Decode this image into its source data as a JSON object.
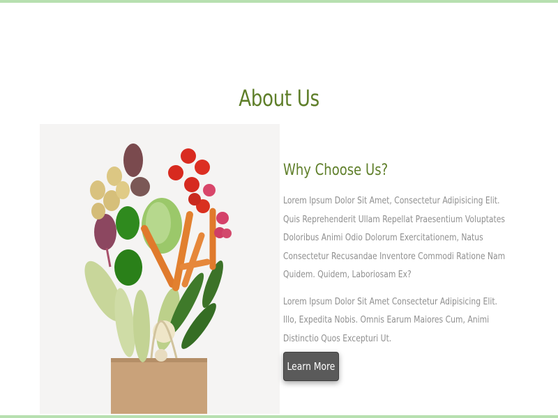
{
  "page": {
    "title": "About Us"
  },
  "image": {
    "icon": "vegetables-in-paper-bag-image"
  },
  "about": {
    "heading": "Why Choose Us?",
    "paragraph_1": "Lorem Ipsum Dolor Sit Amet, Consectetur Adipisicing Elit. Quis Reprehenderit Ullam Repellat Praesentium Voluptates Doloribus Animi Odio Dolorum Exercitationem, Natus Consectetur Recusandae Inventore Commodi Ratione Nam Quidem. Quidem, Laboriosam Ex?",
    "paragraph_2": "Lorem Ipsum Dolor Sit Amet Consectetur Adipisicing Elit. Illo, Expedita Nobis. Omnis Earum Maiores Cum, Animi Distinctio Quos Excepturi Ut.",
    "button_label": "Learn More"
  },
  "colors": {
    "accent_green": "#5f7f2a",
    "border_green": "#b7e0b0",
    "body_text": "#8f8f8f",
    "button_bg": "#5a5a5a"
  }
}
